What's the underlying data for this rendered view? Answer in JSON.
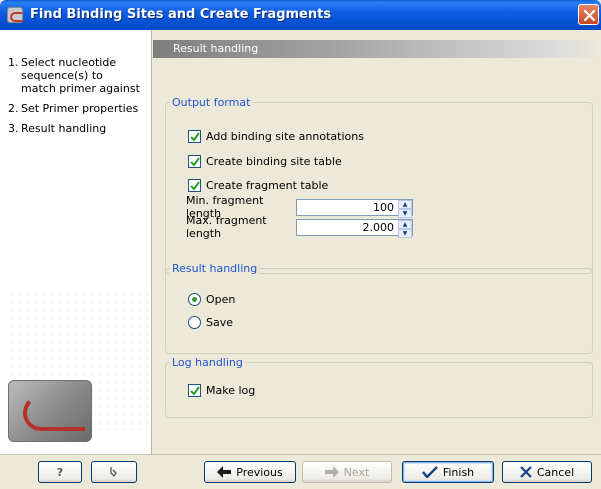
{
  "window": {
    "title": "Find Binding Sites and Create Fragments"
  },
  "steps": [
    {
      "num": "1.",
      "label": "Select nucleotide sequence(s) to match primer against"
    },
    {
      "num": "2.",
      "label": "Set Primer properties"
    },
    {
      "num": "3.",
      "label": "Result handling"
    }
  ],
  "section_header": "Result handling",
  "output_format": {
    "legend": "Output format",
    "checkboxes": [
      {
        "label": "Add binding site annotations",
        "checked": true
      },
      {
        "label": "Create binding site table",
        "checked": true
      },
      {
        "label": "Create fragment table",
        "checked": true
      }
    ],
    "min_fragment": {
      "label": "Min. fragment length",
      "value": "100"
    },
    "max_fragment": {
      "label": "Max. fragment length",
      "value": "2.000"
    }
  },
  "result_handling": {
    "legend": "Result handling",
    "options": [
      {
        "label": "Open",
        "selected": true
      },
      {
        "label": "Save",
        "selected": false
      }
    ]
  },
  "log_handling": {
    "legend": "Log handling",
    "make_log": {
      "label": "Make log",
      "checked": true
    }
  },
  "buttons": {
    "help": "?",
    "previous": "Previous",
    "next": "Next",
    "finish": "Finish",
    "cancel": "Cancel"
  },
  "icons": {
    "close": "close-icon",
    "help": "help-icon",
    "reset": "reset-icon",
    "previous": "arrow-left-icon",
    "next": "arrow-right-icon",
    "finish": "checkmark-icon",
    "cancel": "x-icon"
  },
  "colors": {
    "title_bar": "#0752d2",
    "group_legend": "#2154d4",
    "radio_selected": "#2f9a3c",
    "check": "#21a121"
  }
}
